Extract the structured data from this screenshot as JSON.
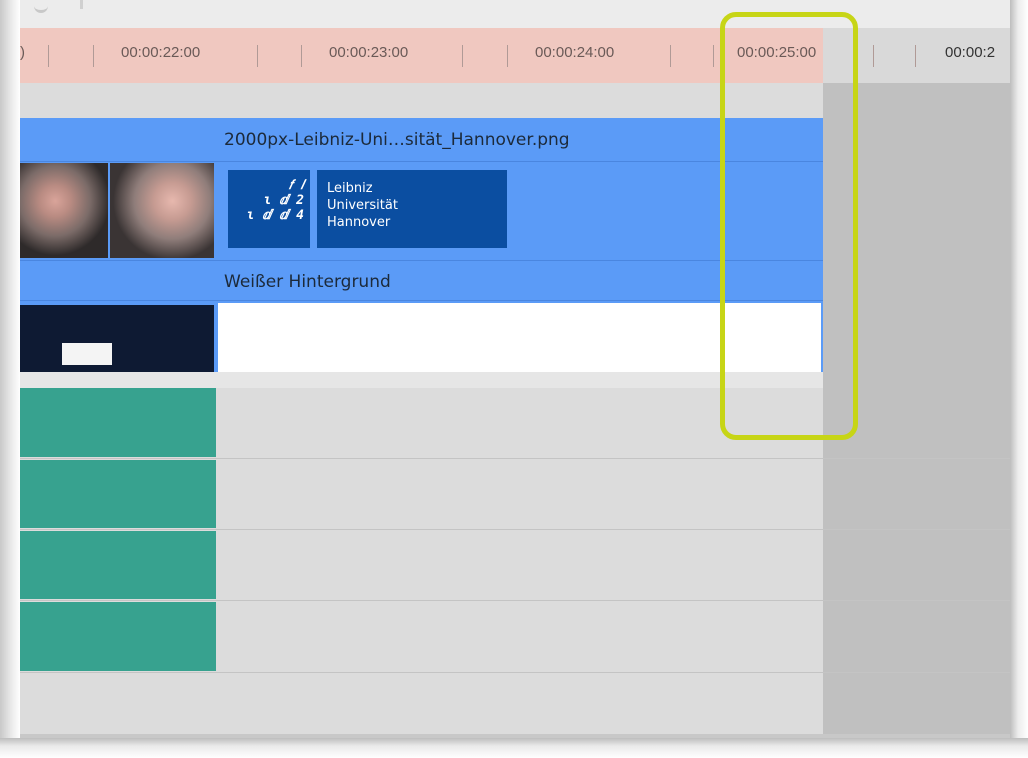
{
  "ruler": {
    "labels": [
      "00:00:22:00",
      "00:00:23:00",
      "00:00:24:00",
      "00:00:25:00",
      "00:00:2"
    ],
    "edge_label": ")"
  },
  "tracks": {
    "image_clip": {
      "title": "2000px-Leibniz-Uni…sität_Hannover.png",
      "logo": {
        "mark_lines": [
          "𝑓 𝑙",
          "ɩ ⅆ 2",
          "ɩ ⅆ ⅆ 4"
        ],
        "text_lines": [
          "Leibniz",
          "Universität",
          "Hannover"
        ]
      }
    },
    "background_clip": {
      "title": "Weißer Hintergrund"
    }
  },
  "colors": {
    "ruler": "#f0c8c0",
    "clip_blue": "#5b9bf7",
    "audio_teal": "#37a28f",
    "highlight": "#c7d516",
    "logo_blue": "#0b4ea1"
  }
}
